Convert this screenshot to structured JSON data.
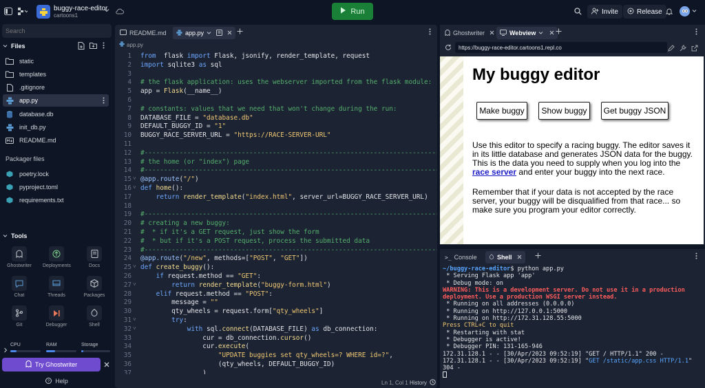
{
  "header": {
    "repl_name": "buggy-race-editor",
    "owner": "cartoons1",
    "run_label": "Run",
    "invite_label": "Invite",
    "release_label": "Release"
  },
  "sidebar": {
    "search_placeholder": "Search",
    "files_title": "Files",
    "files": [
      {
        "name": "static",
        "icon": "folder-icon"
      },
      {
        "name": "templates",
        "icon": "folder-icon"
      },
      {
        "name": ".gitignore",
        "icon": "file-icon"
      },
      {
        "name": "app.py",
        "icon": "python-icon"
      },
      {
        "name": "database.db",
        "icon": "database-icon"
      },
      {
        "name": "init_db.py",
        "icon": "python-icon"
      },
      {
        "name": "README.md",
        "icon": "markdown-icon"
      }
    ],
    "packager_title": "Packager files",
    "packager_files": [
      "poetry.lock",
      "pyproject.toml",
      "requirements.txt"
    ],
    "tools_title": "Tools",
    "tools": [
      "Ghostwriter",
      "Deployments",
      "Docs",
      "Chat",
      "Threads",
      "Packages",
      "Git",
      "Debugger",
      "Shell"
    ],
    "resources": [
      "CPU",
      "RAM",
      "Storage"
    ],
    "try_label": "Try Ghostwriter",
    "help_label": "Help"
  },
  "editor": {
    "tabs": [
      "README.md",
      "app.py"
    ],
    "breadcrumb": "app.py",
    "status_pos": "Ln 1, Col 1",
    "history_label": "History"
  },
  "right_top": {
    "tabs": [
      "Ghostwriter",
      "Webview"
    ],
    "url": "https://buggy-race-editor.cartoons1.repl.co"
  },
  "webview": {
    "heading": "My buggy editor",
    "buttons": [
      "Make buggy",
      "Show buggy",
      "Get buggy JSON"
    ],
    "para1_before": "Use this editor to specify a racing buggy. The editor saves it in its little database and generates JSON data for the buggy. This is the data you need to supply when you log into the ",
    "para1_link": "race server",
    "para1_after": " and enter your buggy into the next race.",
    "para2": "Remember that if your data is not accepted by the race server, your buggy will be disqualified from that race... so make sure you program your editor correctly."
  },
  "console": {
    "tabs": [
      "Console",
      "Shell"
    ],
    "prompt": "~/buggy-race-editor",
    "command": "$ python app.py",
    "out1": " * Serving Flask app 'app'\n * Debug mode: on",
    "warning": "WARNING: This is a development server. Do not use it in a production deployment. Use a production WSGI server instead.",
    "out2": " * Running on all addresses (0.0.0.0)\n * Running on http://127.0.0.1:5000\n * Running on http://172.31.128.55:5000",
    "quit": "Press CTRL+C to quit",
    "out3": " * Restarting with stat\n * Debugger is active!\n * Debugger PIN: 131-165-946",
    "log1": "172.31.128.1 - - [30/Apr/2023 09:52:19] \"GET / HTTP/1.1\" 200 -",
    "log2_pre": "172.31.128.1 - - [30/Apr/2023 09:52:19] \"",
    "log2_blue": "GET /static/app.css HTTP/1.1",
    "log2_post": "\"\n304 -"
  },
  "code_lines": [
    [
      [
        "k",
        "from"
      ],
      [
        "",
        "  flask "
      ],
      [
        "k",
        "import"
      ],
      [
        "",
        " Flask, jsonify, render_template, request"
      ]
    ],
    [
      [
        "k",
        "import"
      ],
      [
        "",
        " sqlite3 "
      ],
      [
        "k",
        "as"
      ],
      [
        "",
        " sql"
      ]
    ],
    [],
    [
      [
        "c",
        "# the flask application: uses the webserver imported from the flask module:"
      ]
    ],
    [
      [
        "",
        "app = "
      ],
      [
        "f",
        "Flask"
      ],
      [
        "",
        "(__name__)"
      ]
    ],
    [],
    [
      [
        "c",
        "# constants: values that we need that won't change during the run:"
      ]
    ],
    [
      [
        "",
        "DATABASE_FILE = "
      ],
      [
        "s",
        "\"database.db\""
      ]
    ],
    [
      [
        "",
        "DEFAULT_BUGGY_ID = "
      ],
      [
        "s",
        "\"1\""
      ]
    ],
    [
      [
        "",
        "BUGGY_RACE_SERVER_URL = "
      ],
      [
        "s",
        "\"https://RACE-SERVER-URL\""
      ]
    ],
    [],
    [
      [
        "c",
        "#-----------------------------------------------------------------------------"
      ]
    ],
    [
      [
        "c",
        "# the home (or \"index\") page"
      ]
    ],
    [
      [
        "c",
        "#-----------------------------------------------------------------------------"
      ]
    ],
    [
      [
        "d",
        "@app.route"
      ],
      [
        "",
        "("
      ],
      [
        "s",
        "\"/\""
      ],
      [
        "",
        ")"
      ]
    ],
    [
      [
        "k",
        "def"
      ],
      [
        "",
        " "
      ],
      [
        "f",
        "home"
      ],
      [
        "",
        "():"
      ]
    ],
    [
      [
        "",
        ""
      ],
      [
        "k",
        "    return"
      ],
      [
        "",
        " "
      ],
      [
        "f",
        "render_template"
      ],
      [
        "",
        "("
      ],
      [
        "s",
        "\"index.html\""
      ],
      [
        "",
        ", server_url=BUGGY_RACE_SERVER_URL)"
      ]
    ],
    [],
    [
      [
        "c",
        "#-----------------------------------------------------------------------------"
      ]
    ],
    [
      [
        "c",
        "# creating a new buggy:"
      ]
    ],
    [
      [
        "c",
        "#  * if it's a GET request, just show the form"
      ]
    ],
    [
      [
        "c",
        "#  * but if it's a POST request, process the submitted data"
      ]
    ],
    [
      [
        "c",
        "#-----------------------------------------------------------------------------"
      ]
    ],
    [
      [
        "d",
        "@app.route"
      ],
      [
        "",
        "("
      ],
      [
        "s",
        "\"/new\""
      ],
      [
        "",
        ", methods=["
      ],
      [
        "s",
        "\"POST\""
      ],
      [
        "",
        ", "
      ],
      [
        "s",
        "\"GET\""
      ],
      [
        "",
        "])"
      ]
    ],
    [
      [
        "k",
        "def"
      ],
      [
        "",
        " "
      ],
      [
        "f",
        "create_buggy"
      ],
      [
        "",
        "():"
      ]
    ],
    [
      [
        "k",
        "    if"
      ],
      [
        "",
        " request.method == "
      ],
      [
        "s",
        "\"GET\""
      ],
      [
        "",
        ":"
      ]
    ],
    [
      [
        "k",
        "        return"
      ],
      [
        "",
        " "
      ],
      [
        "f",
        "render_template"
      ],
      [
        "",
        "("
      ],
      [
        "s",
        "\"buggy-form.html\""
      ],
      [
        "",
        ")"
      ]
    ],
    [
      [
        "k",
        "    elif"
      ],
      [
        "",
        " request.method == "
      ],
      [
        "s",
        "\"POST\""
      ],
      [
        "",
        ":"
      ]
    ],
    [
      [
        "",
        "        message = "
      ],
      [
        "s",
        "\"\""
      ]
    ],
    [
      [
        "",
        "        qty_wheels = request.form["
      ],
      [
        "s",
        "\"qty_wheels\""
      ],
      [
        "",
        "]"
      ]
    ],
    [
      [
        "k",
        "        try"
      ],
      [
        "",
        ":"
      ]
    ],
    [
      [
        "k",
        "            with"
      ],
      [
        "",
        " sql."
      ],
      [
        "f",
        "connect"
      ],
      [
        "",
        "(DATABASE_FILE) "
      ],
      [
        "k",
        "as"
      ],
      [
        "",
        " db_connection:"
      ]
    ],
    [
      [
        "",
        "                cur = db_connection."
      ],
      [
        "f",
        "cursor"
      ],
      [
        "",
        "()"
      ]
    ],
    [
      [
        "",
        "                cur."
      ],
      [
        "f",
        "execute"
      ],
      [
        "",
        "("
      ]
    ],
    [
      [
        "s",
        "                    \"UPDATE buggies set qty_wheels=? WHERE id=?\""
      ],
      [
        "",
        ","
      ]
    ],
    [
      [
        "",
        "                    (qty_wheels, DEFAULT_BUGGY_ID)"
      ]
    ],
    [
      [
        "",
        "                )"
      ]
    ]
  ]
}
